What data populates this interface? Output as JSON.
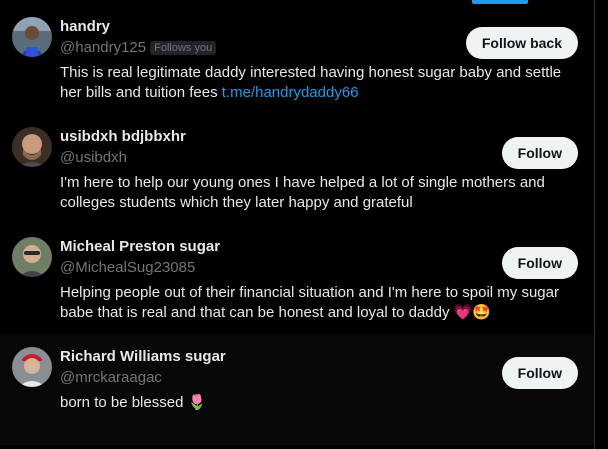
{
  "colors": {
    "background": "#000000",
    "accent": "#1d9bf0",
    "text_primary": "#e7e9ea",
    "text_secondary": "#71767b",
    "button_bg": "#eff3f4"
  },
  "users": [
    {
      "display_name": "handry",
      "handle": "@handry125",
      "badge": "Follows you",
      "button_label": "Follow back",
      "bio_text": "This is real legitimate daddy interested having honest sugar baby and settle her bills and tuition fees ",
      "bio_link": "t.me/handrydaddy66",
      "avatar_icon": "person-avatar"
    },
    {
      "display_name": "usibdxh bdjbbxhr",
      "handle": "@usibdxh",
      "button_label": "Follow",
      "bio_text": "I'm here to help our young ones I have helped a lot of single mothers and colleges students which they later happy and grateful",
      "avatar_icon": "person-avatar"
    },
    {
      "display_name": "Micheal Preston sugar",
      "handle": "@MichealSug23085",
      "button_label": "Follow",
      "bio_text": "Helping people out of their financial situation and I'm here to spoil my sugar babe that is real and that can be honest and loyal to daddy ",
      "bio_emojis": [
        "💗",
        "🤩"
      ],
      "avatar_icon": "person-avatar"
    },
    {
      "display_name": "Richard Williams sugar",
      "handle": "@mrckaraagac",
      "button_label": "Follow",
      "bio_text": "born to be blessed ",
      "bio_emojis": [
        "🌷"
      ],
      "avatar_icon": "person-avatar"
    }
  ]
}
